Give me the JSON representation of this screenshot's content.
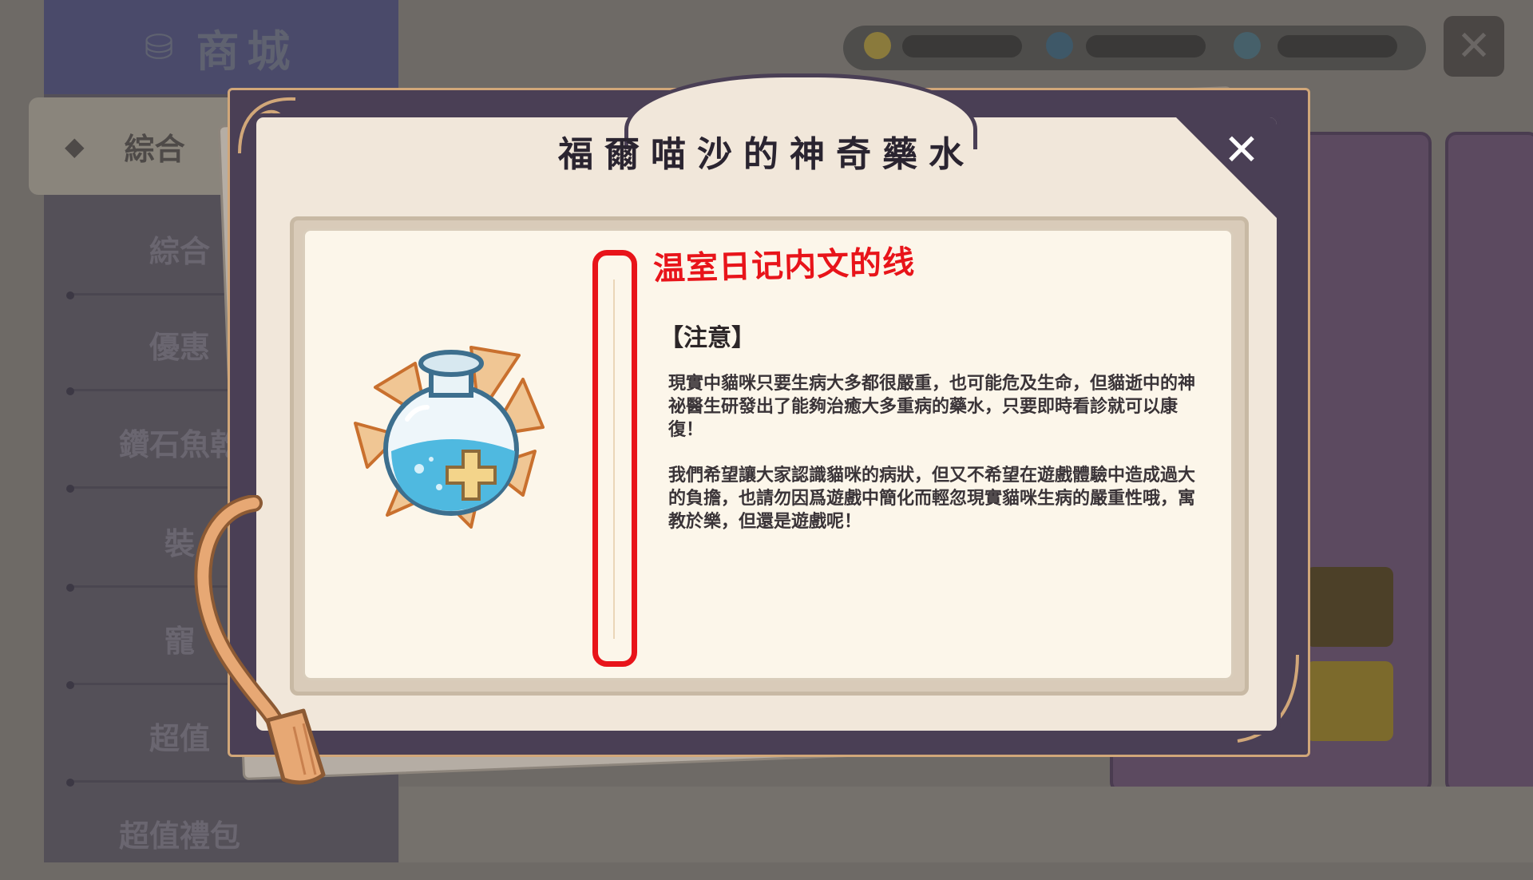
{
  "background": {
    "shop_title": "商城",
    "active_tab": "綜合",
    "menu_items": [
      "綜合",
      "優惠",
      "鑽石魚乾",
      "裝",
      "寵",
      "超值",
      "超值禮包"
    ]
  },
  "modal": {
    "title": "福爾喵沙的神奇藥水",
    "close_label": "✕",
    "annotation": "温室日记内文的线",
    "notice_heading": "【注意】",
    "paragraph_1": "現實中貓咪只要生病大多都很嚴重，也可能危及生命，但貓逝中的神祕醫生研發出了能夠治癒大多重病的藥水，只要即時看診就可以康復！",
    "paragraph_2": "我們希望讓大家認識貓咪的病狀，但又不希望在遊戲體驗中造成過大的負擔，也請勿因爲遊戲中簡化而輕忽現實貓咪生病的嚴重性哦，寓教於樂，但還是遊戲呢！",
    "item_icon": "potion-icon"
  },
  "colors": {
    "frame": "#4a3f55",
    "paper": "#f1e7da",
    "annotation": "#e8141a",
    "potion_liquid": "#4fb9e0",
    "potion_cross": "#f3d48a"
  }
}
